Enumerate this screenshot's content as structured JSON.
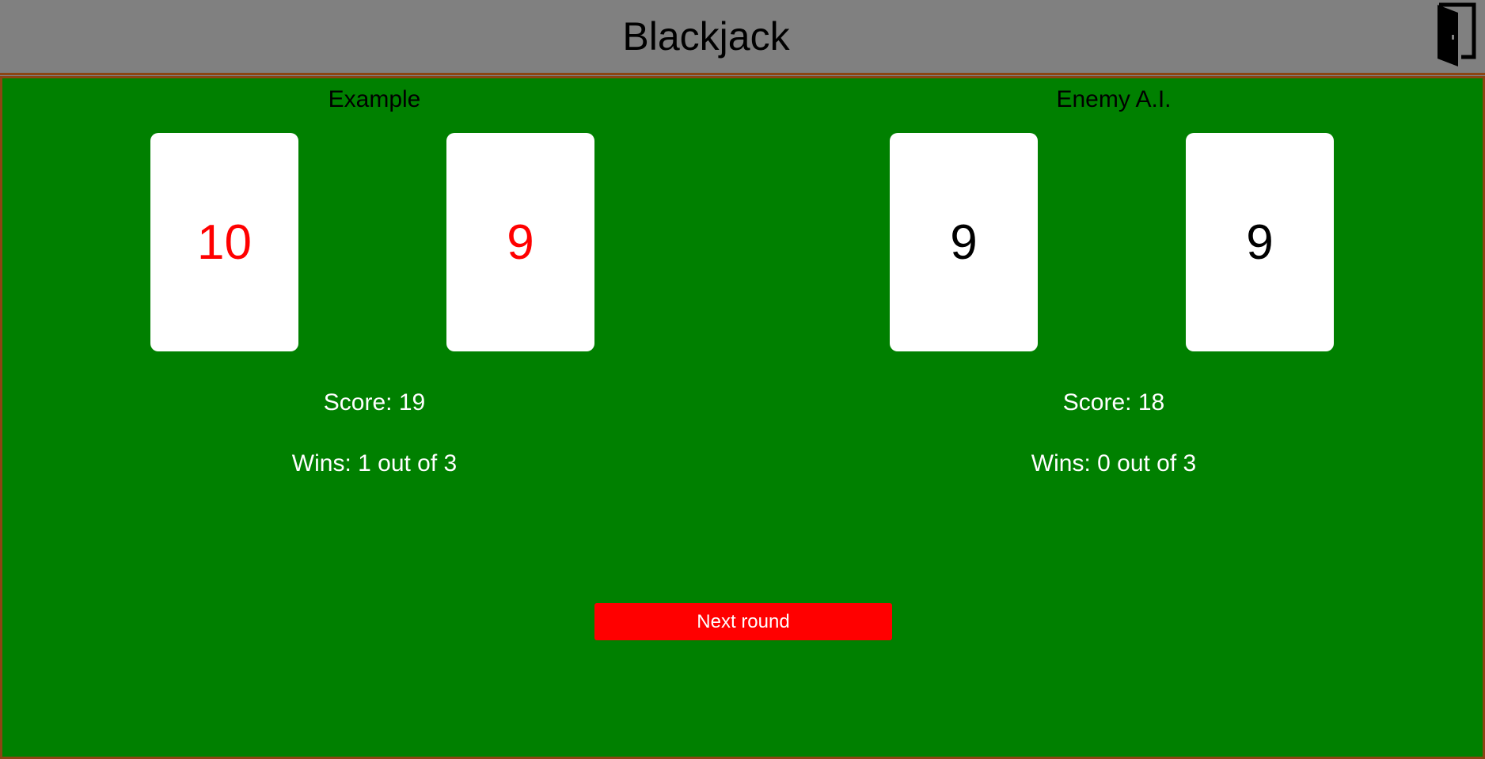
{
  "header": {
    "title": "Blackjack",
    "exit_icon": "door-exit-icon"
  },
  "players": [
    {
      "name": "Example",
      "cards": [
        {
          "value": "10",
          "color": "#ff0000"
        },
        {
          "value": "9",
          "color": "#ff0000"
        }
      ],
      "score_text": "Score: 19",
      "wins_text": "Wins: 1 out of 3"
    },
    {
      "name": "Enemy A.I.",
      "cards": [
        {
          "value": "9",
          "color": "#000000"
        },
        {
          "value": "9",
          "color": "#000000"
        }
      ],
      "score_text": "Score: 18",
      "wins_text": "Wins: 0 out of 3"
    }
  ],
  "actions": {
    "next_round_label": "Next round"
  },
  "colors": {
    "table": "#008000",
    "header": "#808080",
    "border": "#8b4513",
    "button": "#ff0000"
  }
}
